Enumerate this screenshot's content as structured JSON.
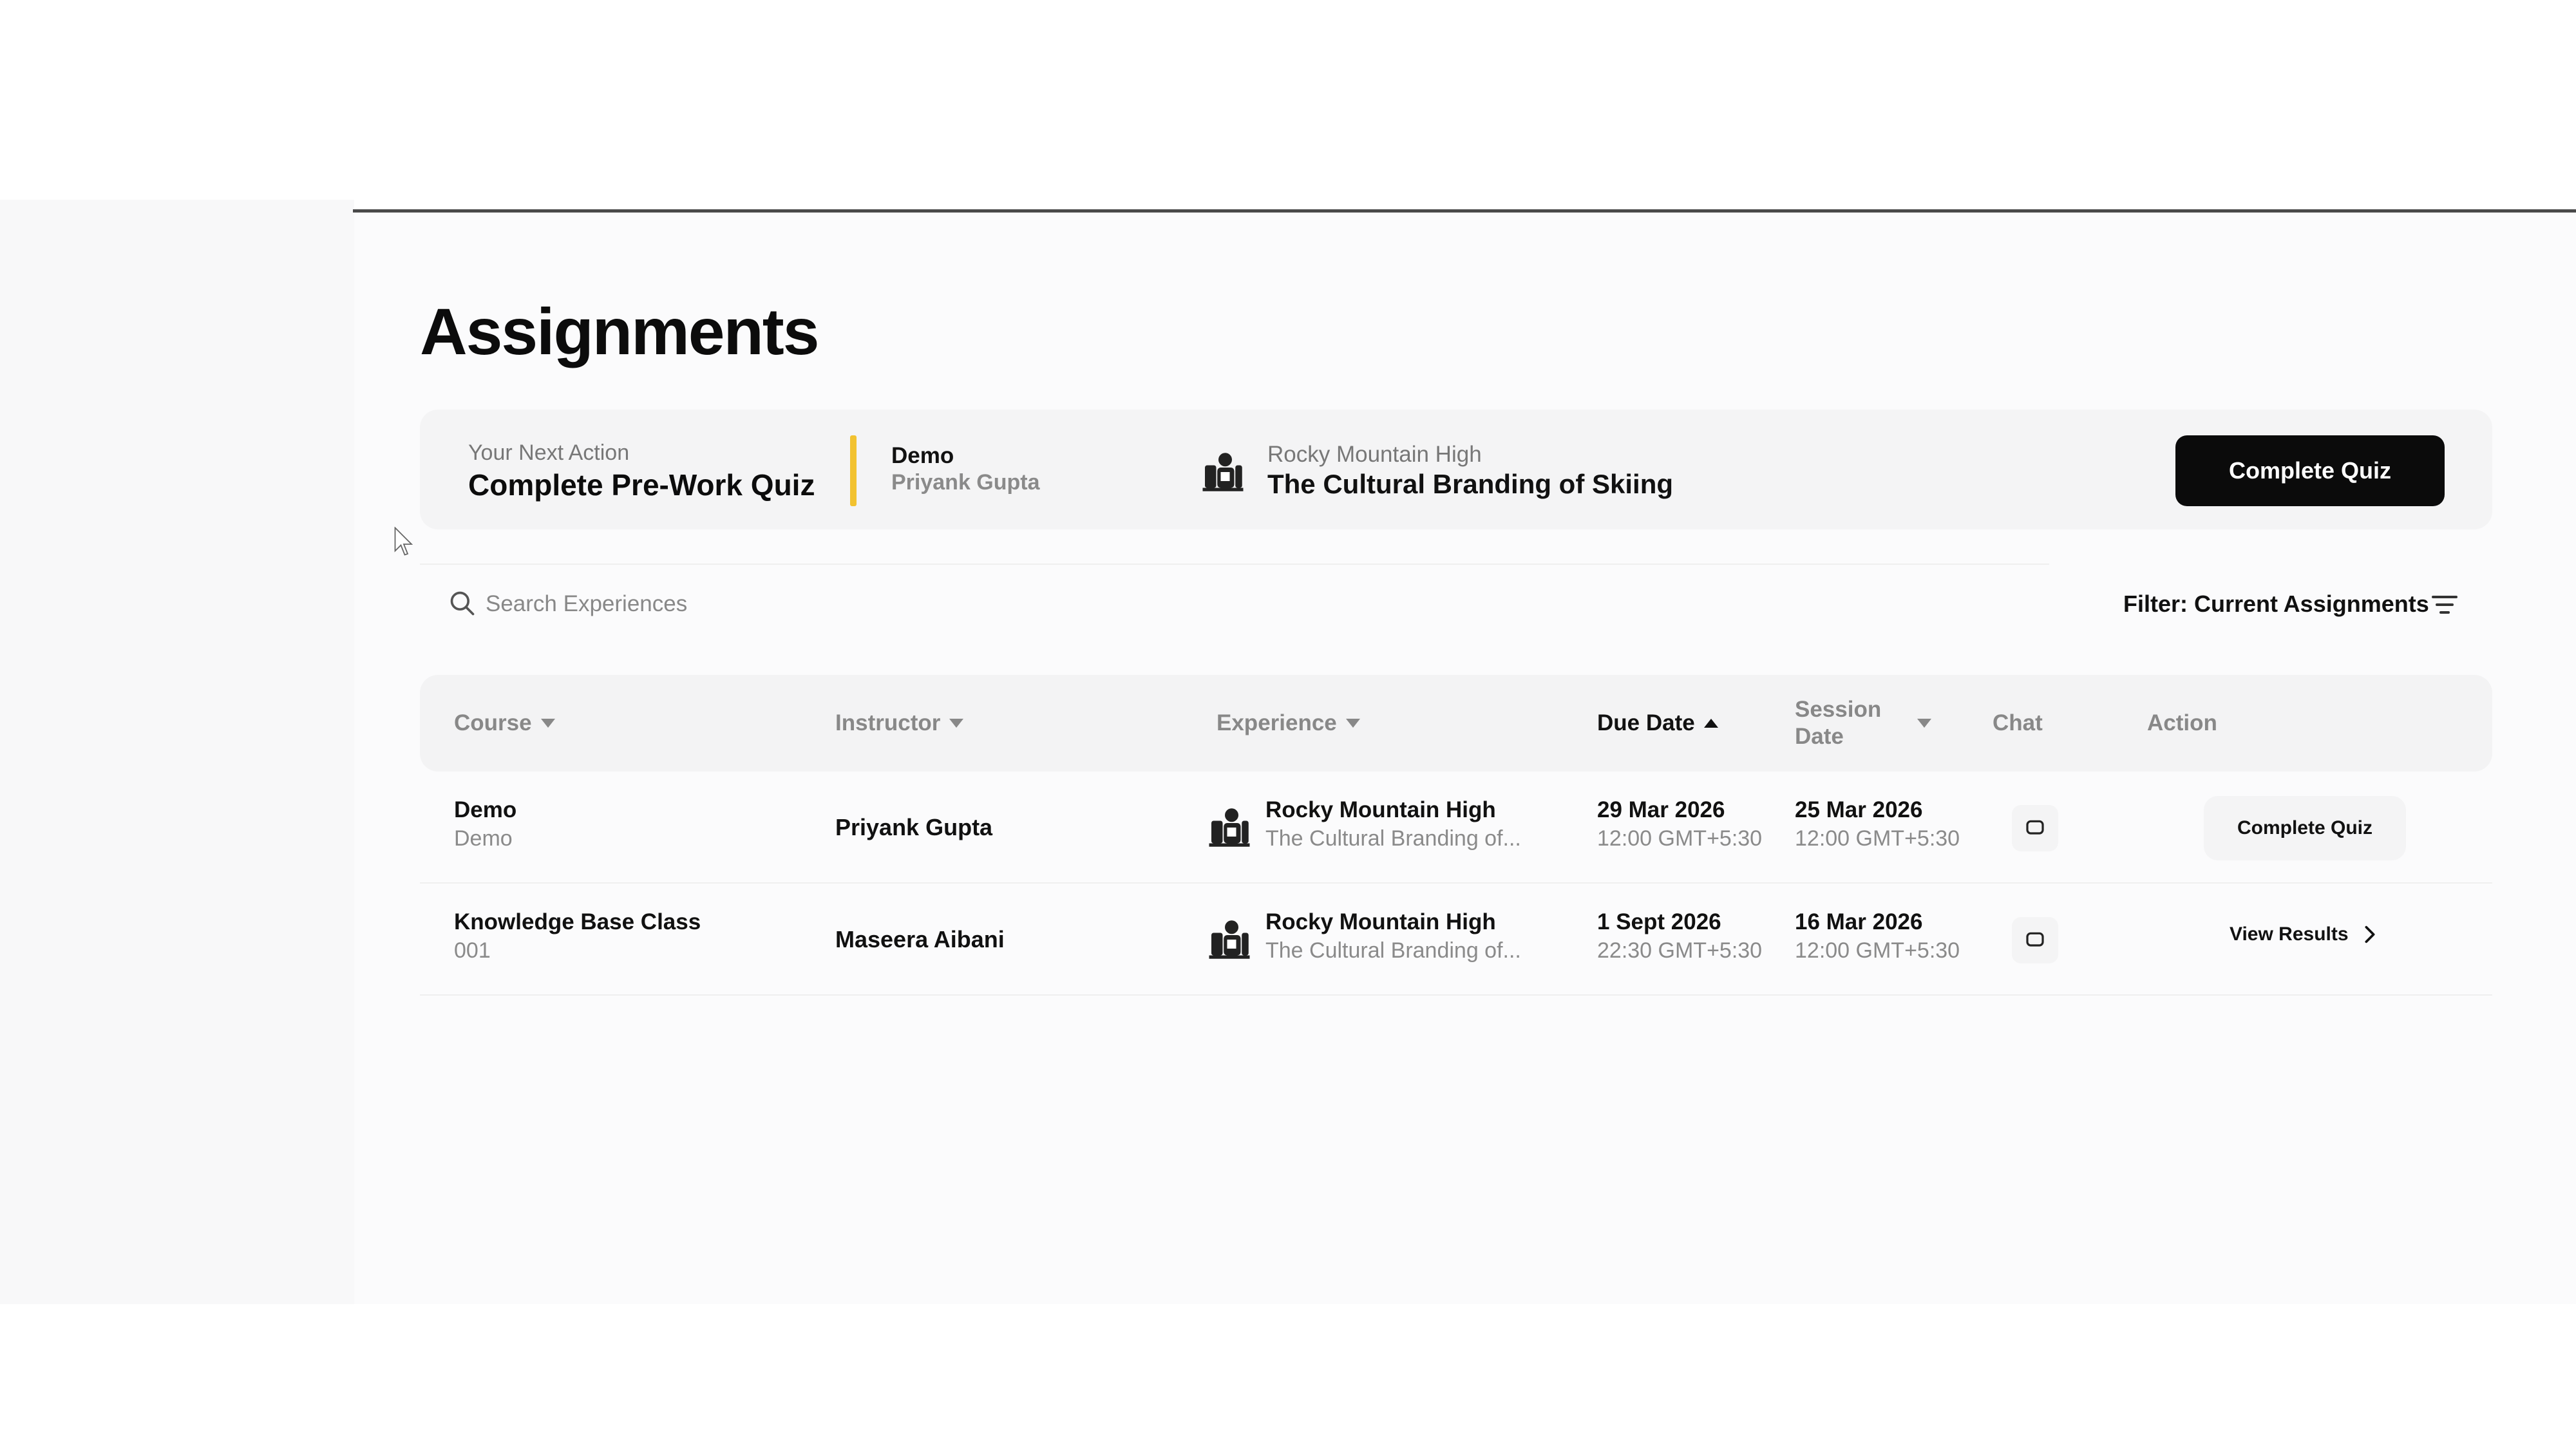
{
  "page": {
    "title": "Assignments"
  },
  "next_action": {
    "label": "Your Next Action",
    "title": "Complete Pre-Work Quiz",
    "course": "Demo",
    "instructor": "Priyank Gupta",
    "experience_subtitle": "Rocky Mountain High",
    "experience_title": "The Cultural Branding of Skiing",
    "button_label": "Complete Quiz",
    "accent_color": "#f2c230"
  },
  "search": {
    "placeholder": "Search Experiences",
    "value": ""
  },
  "filter": {
    "label": "Filter: Current Assignments"
  },
  "table": {
    "columns": {
      "course": "Course",
      "instructor": "Instructor",
      "experience": "Experience",
      "due_date": "Due Date",
      "session_date_line1": "Session",
      "session_date_line2": "Date",
      "chat": "Chat",
      "action": "Action"
    },
    "sort": {
      "column": "Due Date",
      "direction": "ascending"
    },
    "rows": [
      {
        "course": "Demo",
        "course_sub": "Demo",
        "instructor": "Priyank Gupta",
        "experience_title": "Rocky Mountain High",
        "experience_sub": "The Cultural Branding of...",
        "due_date": "29 Mar 2026",
        "due_time": "12:00 GMT+5:30",
        "session_date": "25 Mar 2026",
        "session_time": "12:00 GMT+5:30",
        "action_label": "Complete Quiz"
      },
      {
        "course": "Knowledge Base Class",
        "course_sub": "001",
        "instructor": "Maseera Aibani",
        "experience_title": "Rocky Mountain High",
        "experience_sub": "The Cultural Branding of...",
        "due_date": "1 Sept 2026",
        "due_time": "22:30 GMT+5:30",
        "session_date": "16 Mar 2026",
        "session_time": "12:00 GMT+5:30",
        "action_label": "View Results"
      }
    ]
  },
  "icons": {
    "experience": "skier-icon",
    "chat": "chat-bubble-icon",
    "search": "search-icon",
    "filter": "filter-icon",
    "chevron": "chevron-right-icon"
  }
}
